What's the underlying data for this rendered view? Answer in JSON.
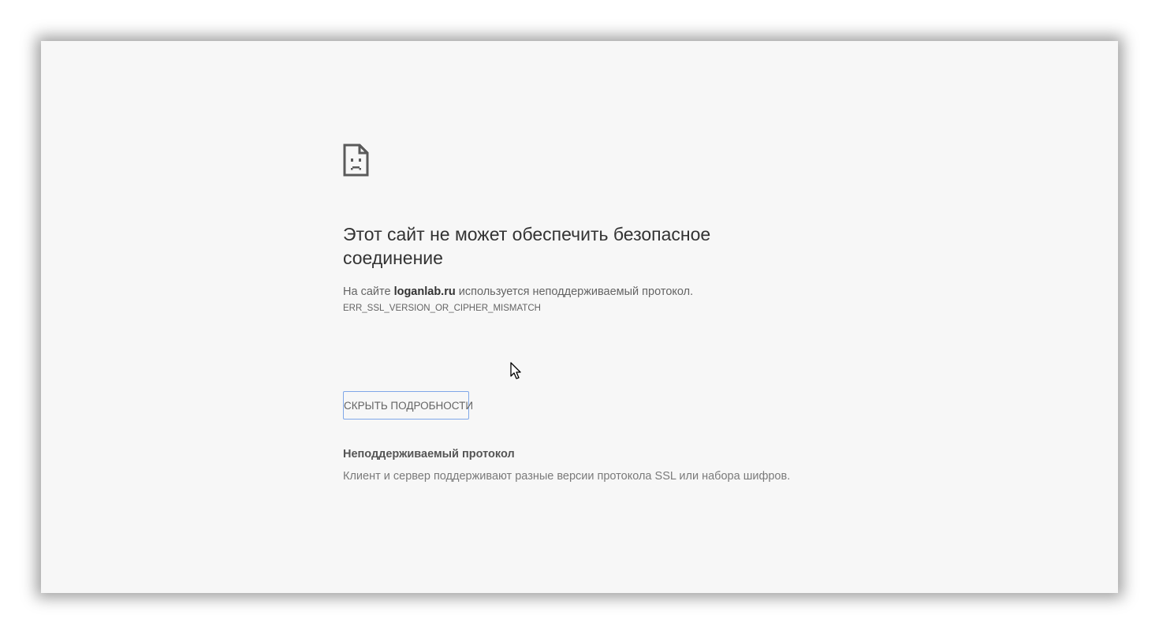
{
  "error_page": {
    "icon": "sad-page-icon",
    "heading": "Этот сайт не может обеспечить безопасное соединение",
    "summary_prefix": "На сайте ",
    "site": "loganlab.ru",
    "summary_suffix": " используется неподдерживаемый протокол.",
    "error_code": "ERR_SSL_VERSION_OR_CIPHER_MISMATCH",
    "details_button_label": "СКРЫТЬ ПОДРОБНОСТИ",
    "details_title": "Неподдерживаемый протокол",
    "details_text": "Клиент и сервер поддерживают разные версии протокола SSL или набора шифров."
  },
  "colors": {
    "background": "#f7f7f7",
    "heading": "#333333",
    "body_text": "#646464",
    "button_focus_border": "#7fa7e8"
  }
}
